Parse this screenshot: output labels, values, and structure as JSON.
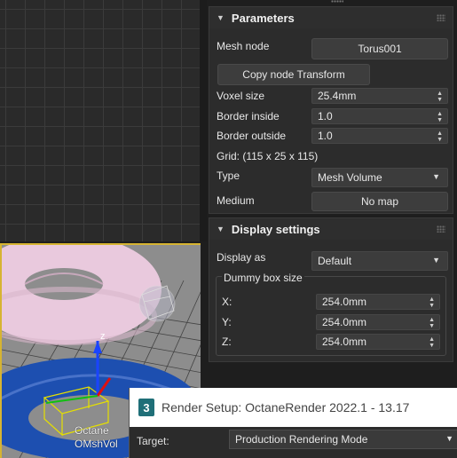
{
  "viewport": {
    "octane_label_line1": "Octane",
    "octane_label_line2": "OMshVol",
    "gizmo_axis": "z"
  },
  "parameters": {
    "title": "Parameters",
    "mesh_node_label": "Mesh node",
    "mesh_node_value": "Torus001",
    "copy_transform_label": "Copy node Transform",
    "voxel_size_label": "Voxel size",
    "voxel_size_value": "25.4mm",
    "border_inside_label": "Border inside",
    "border_inside_value": "1.0",
    "border_outside_label": "Border outside",
    "border_outside_value": "1.0",
    "grid_text": "Grid: (115 x 25 x 115)",
    "type_label": "Type",
    "type_value": "Mesh Volume",
    "medium_label": "Medium",
    "medium_value": "No map"
  },
  "display_settings": {
    "title": "Display settings",
    "display_as_label": "Display as",
    "display_as_value": "Default",
    "dummy_box_title": "Dummy box size",
    "x_label": "X:",
    "x_value": "254.0mm",
    "y_label": "Y:",
    "y_value": "254.0mm",
    "z_label": "Z:",
    "z_value": "254.0mm"
  },
  "render_setup": {
    "icon": "3",
    "title": "Render Setup: OctaneRender 2022.1 - 13.17",
    "target_label": "Target:",
    "target_value": "Production Rendering Mode"
  },
  "colors": {
    "active_viewport_border": "#d6b431",
    "torus_top": "#e8c8dc",
    "torus_bottom": "#1d4fb0"
  }
}
